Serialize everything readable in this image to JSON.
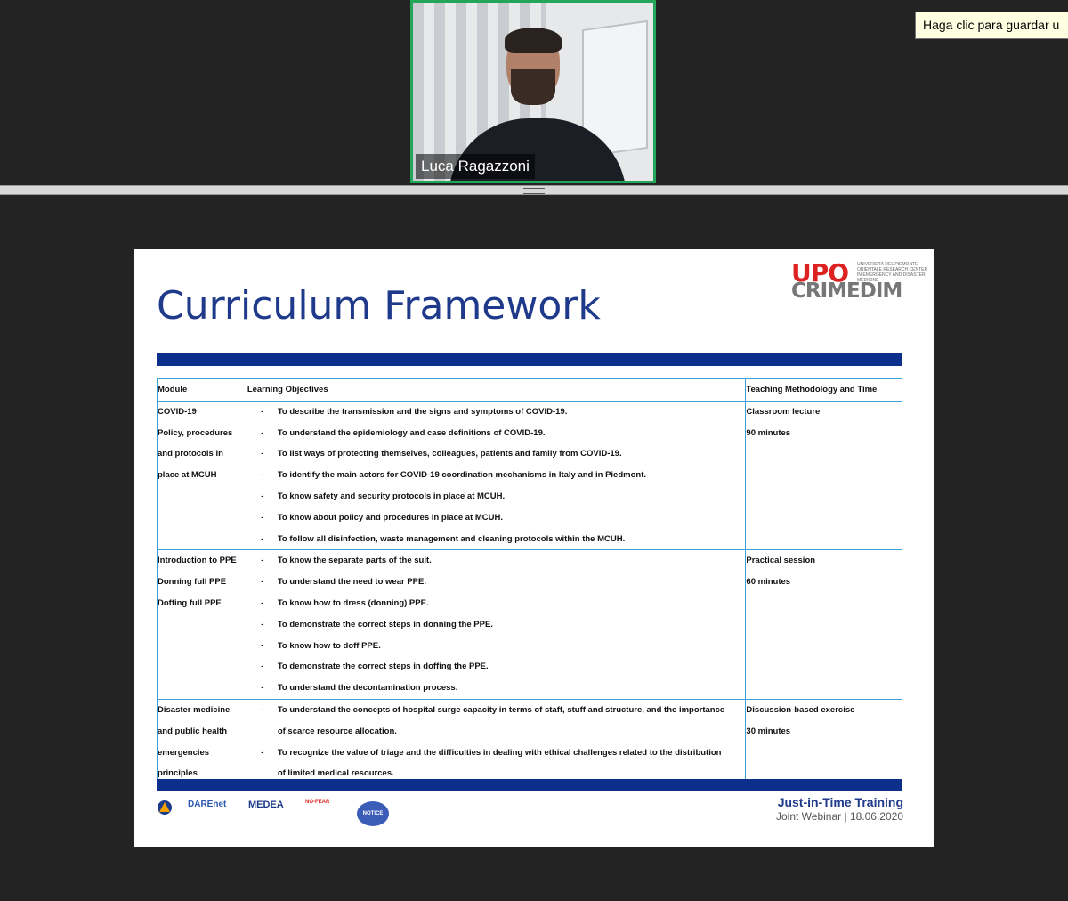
{
  "participant": {
    "name": "Luca Ragazzoni"
  },
  "tooltip": {
    "text": "Haga clic para guardar u"
  },
  "slide": {
    "title": "Curriculum Framework",
    "logo": {
      "primary": "UPO",
      "secondary": "CRIMEDIM",
      "small_text": "UNIVERSITÀ DEL PIEMONTE ORIENTALE RESEARCH CENTER IN EMERGENCY AND DISASTER MEDICINE"
    },
    "table": {
      "headers": [
        "Module",
        "Learning Objectives",
        "Teaching Methodology and Time"
      ],
      "rows": [
        {
          "module": [
            "COVID-19",
            "Policy, procedures",
            "and protocols in",
            "place at MCUH"
          ],
          "objectives": [
            {
              "dash": "-",
              "text": "To describe the transmission and the signs and symptoms of COVID-19."
            },
            {
              "dash": "-",
              "text": "To understand the epidemiology and case definitions of COVID-19."
            },
            {
              "dash": "-",
              "text": "To list ways of protecting themselves, colleagues, patients and family from COVID-19."
            },
            {
              "dash": "-",
              "text": "To identify the main actors for COVID-19 coordination mechanisms in Italy and in Piedmont."
            },
            {
              "dash": "-",
              "text": "To know safety and security protocols in place at MCUH."
            },
            {
              "dash": "-",
              "text": "To know about policy and procedures in place at MCUH."
            },
            {
              "dash": "-",
              "text": "To follow all disinfection, waste management and cleaning protocols within the MCUH."
            }
          ],
          "method": [
            "Classroom lecture",
            "90 minutes"
          ]
        },
        {
          "module": [
            "Introduction to PPE",
            "Donning full PPE",
            "Doffing full PPE"
          ],
          "objectives": [
            {
              "dash": "-",
              "text": "To know the separate parts of the suit."
            },
            {
              "dash": "-",
              "text": "To understand the need to wear PPE."
            },
            {
              "dash": "-",
              "text": "To know how to dress (donning) PPE."
            },
            {
              "dash": "-",
              "text": "To demonstrate the correct steps in donning the PPE."
            },
            {
              "dash": "-",
              "text": "To know how to doff PPE."
            },
            {
              "dash": "-",
              "text": "To demonstrate the correct steps in doffing the PPE."
            },
            {
              "dash": "-",
              "text": "To understand the decontamination process."
            }
          ],
          "method": [
            "Practical session",
            "60 minutes"
          ]
        },
        {
          "module": [
            "Disaster medicine",
            "and public health",
            "emergencies",
            "principles"
          ],
          "objectives": [
            {
              "dash": "-",
              "text": "To understand the concepts of hospital surge capacity in terms of staff, stuff and structure, and the importance"
            },
            {
              "dash": "",
              "text": "of scarce resource allocation."
            },
            {
              "dash": "-",
              "text": "To recognize the value of triage and the difficulties in dealing with ethical challenges related to the distribution"
            },
            {
              "dash": "",
              "text": "of limited medical resources."
            }
          ],
          "method": [
            "Discussion-based exercise",
            "30 minutes"
          ]
        }
      ]
    },
    "footer": {
      "title": "Just-in-Time Training",
      "subtitle": "Joint Webinar | 18.06.2020"
    },
    "partners": [
      "DAREnet",
      "MEDEA",
      "NO-FEAR",
      "NOTICE"
    ]
  },
  "colors": {
    "title": "#1f3a8a",
    "bar": "#0b2f8a",
    "table_border": "#3aa0d8",
    "video_border": "#23a55a"
  }
}
